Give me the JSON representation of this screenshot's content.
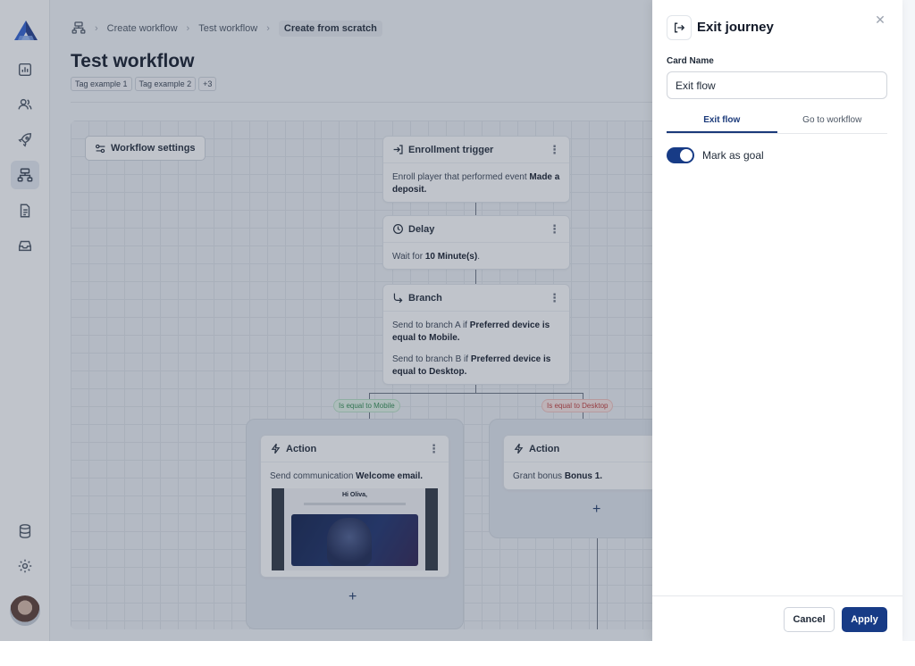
{
  "breadcrumbs": [
    "Create workflow",
    "Test workflow",
    "Create from scratch"
  ],
  "page": {
    "title": "Test workflow",
    "tags": [
      "Tag example 1",
      "Tag example 2",
      "+3"
    ]
  },
  "canvas": {
    "settings_label": "Workflow settings",
    "enrollment": {
      "title": "Enrollment trigger",
      "text": "Enroll player that performed event ",
      "bold": "Made a deposit",
      "end": "."
    },
    "delay": {
      "title": "Delay",
      "text": "Wait for ",
      "bold": "10 Minute(s)",
      "end": "."
    },
    "branch": {
      "title": "Branch",
      "a_text": "Send to branch A if ",
      "a_bold": "Preferred device is equal to Mobile",
      "b_text": "Send to branch B if ",
      "b_bold": "Preferred device is equal to Desktop",
      "end": "."
    },
    "pill_mobile": "Is equal to Mobile",
    "pill_desktop": "Is equal to Desktop",
    "action_a": {
      "title": "Action",
      "text": "Send communication ",
      "bold": "Welcome email",
      "end": ".",
      "email_greeting": "Hi Oliva,"
    },
    "action_b": {
      "title": "Action",
      "text": "Grant bonus ",
      "bold": "Bonus 1",
      "end": "."
    },
    "plus": "+"
  },
  "drawer": {
    "title": "Exit journey",
    "card_name_label": "Card Name",
    "card_name_value": "Exit flow",
    "tabs": [
      "Exit flow",
      "Go to workflow"
    ],
    "toggle_label": "Mark as goal",
    "toggle_on": true,
    "cancel_label": "Cancel",
    "apply_label": "Apply"
  },
  "colors": {
    "primary": "#173b86",
    "success": "#2f8a4e",
    "danger": "#c03a36"
  }
}
